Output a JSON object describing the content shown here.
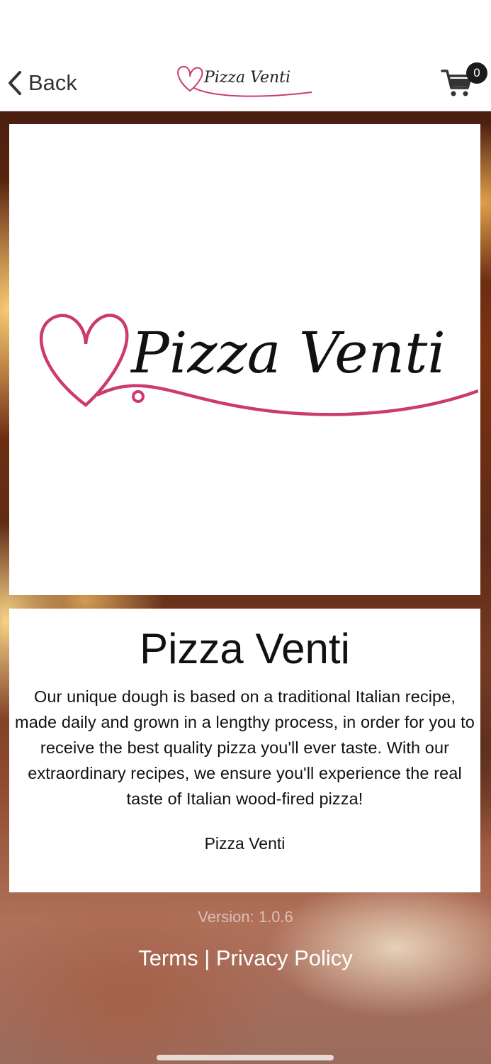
{
  "header": {
    "back_label": "Back",
    "logo_text": "Pizza Venti",
    "cart_count": "0"
  },
  "logo_card": {
    "logo_text": "Pizza Venti"
  },
  "info": {
    "title": "Pizza Venti",
    "description": "Our unique dough is based on a traditional Italian recipe, made daily and grown in a lengthy process, in order for you to receive the best quality pizza you'll ever taste. With our extraordinary recipes, we ensure you'll experience the real taste of Italian wood-fired pizza!",
    "signature": "Pizza Venti"
  },
  "footer": {
    "version": "Version: 1.0.6",
    "terms_label": "Terms",
    "separator": " | ",
    "privacy_label": "Privacy Policy"
  },
  "colors": {
    "brand_pink": "#cc3a70",
    "text_dark": "#111111",
    "badge": "#1b1b1b"
  },
  "icons": [
    "chevron-left-icon",
    "cart-icon",
    "heart-logo-icon"
  ]
}
